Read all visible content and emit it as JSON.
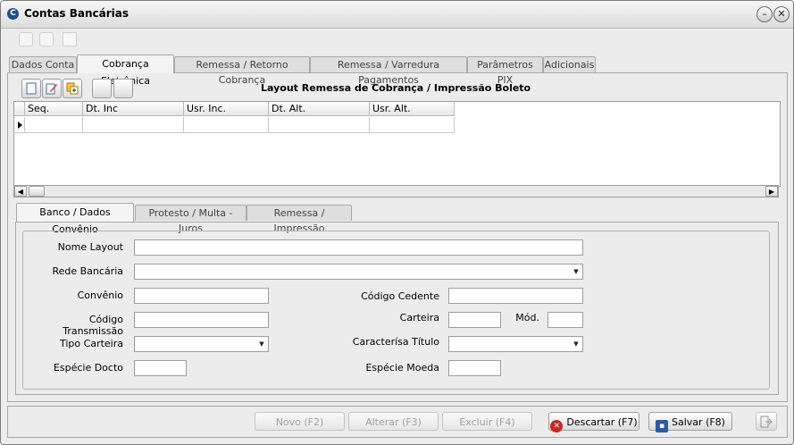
{
  "window": {
    "title": "Contas Bancárias",
    "app_icon": "C"
  },
  "tabs": [
    {
      "label": "Dados Conta"
    },
    {
      "label": "Cobrança Eletrônica",
      "active": true
    },
    {
      "label": "Remessa / Retorno Cobrança"
    },
    {
      "label": "Remessa / Varredura Pagamentos"
    },
    {
      "label": "Parâmetros PIX"
    },
    {
      "label": "Adicionais"
    }
  ],
  "section_title": "Layout Remessa de Cobrança / Impressão Boleto",
  "grid": {
    "columns": [
      "Seq.",
      "Dt. Inc",
      "Usr. Inc.",
      "Dt. Alt.",
      "Usr. Alt."
    ]
  },
  "subtabs": [
    {
      "label": "Banco  / Dados Convênio",
      "active": true
    },
    {
      "label": "Protesto / Multa - Juros"
    },
    {
      "label": "Remessa  / Impressão"
    }
  ],
  "form": {
    "nome_layout": {
      "label": "Nome Layout",
      "value": ""
    },
    "rede_bancaria": {
      "label": "Rede Bancária",
      "value": ""
    },
    "convenio": {
      "label": "Convênio",
      "value": ""
    },
    "codigo_transmissao": {
      "label": "Código Transmissão",
      "value": ""
    },
    "tipo_carteira": {
      "label": "Tipo Carteira",
      "value": ""
    },
    "especie_docto": {
      "label": "Espécie Docto",
      "value": ""
    },
    "codigo_cedente": {
      "label": "Código Cedente",
      "value": ""
    },
    "carteira": {
      "label": "Carteira",
      "value": ""
    },
    "mod": {
      "label": "Mód.",
      "value": ""
    },
    "caracteristica_titulo": {
      "label": "Caracterísa Título",
      "value": ""
    },
    "especie_moeda": {
      "label": "Espécie Moeda",
      "value": ""
    }
  },
  "actions": {
    "novo": "Novo (F2)",
    "alterar": "Alterar (F3)",
    "excluir": "Excluir (F4)",
    "descartar": "Descartar (F7)",
    "salvar": "Salvar (F8)"
  },
  "colors": {
    "accent": "#1f4f86",
    "discard": "#c62828"
  }
}
